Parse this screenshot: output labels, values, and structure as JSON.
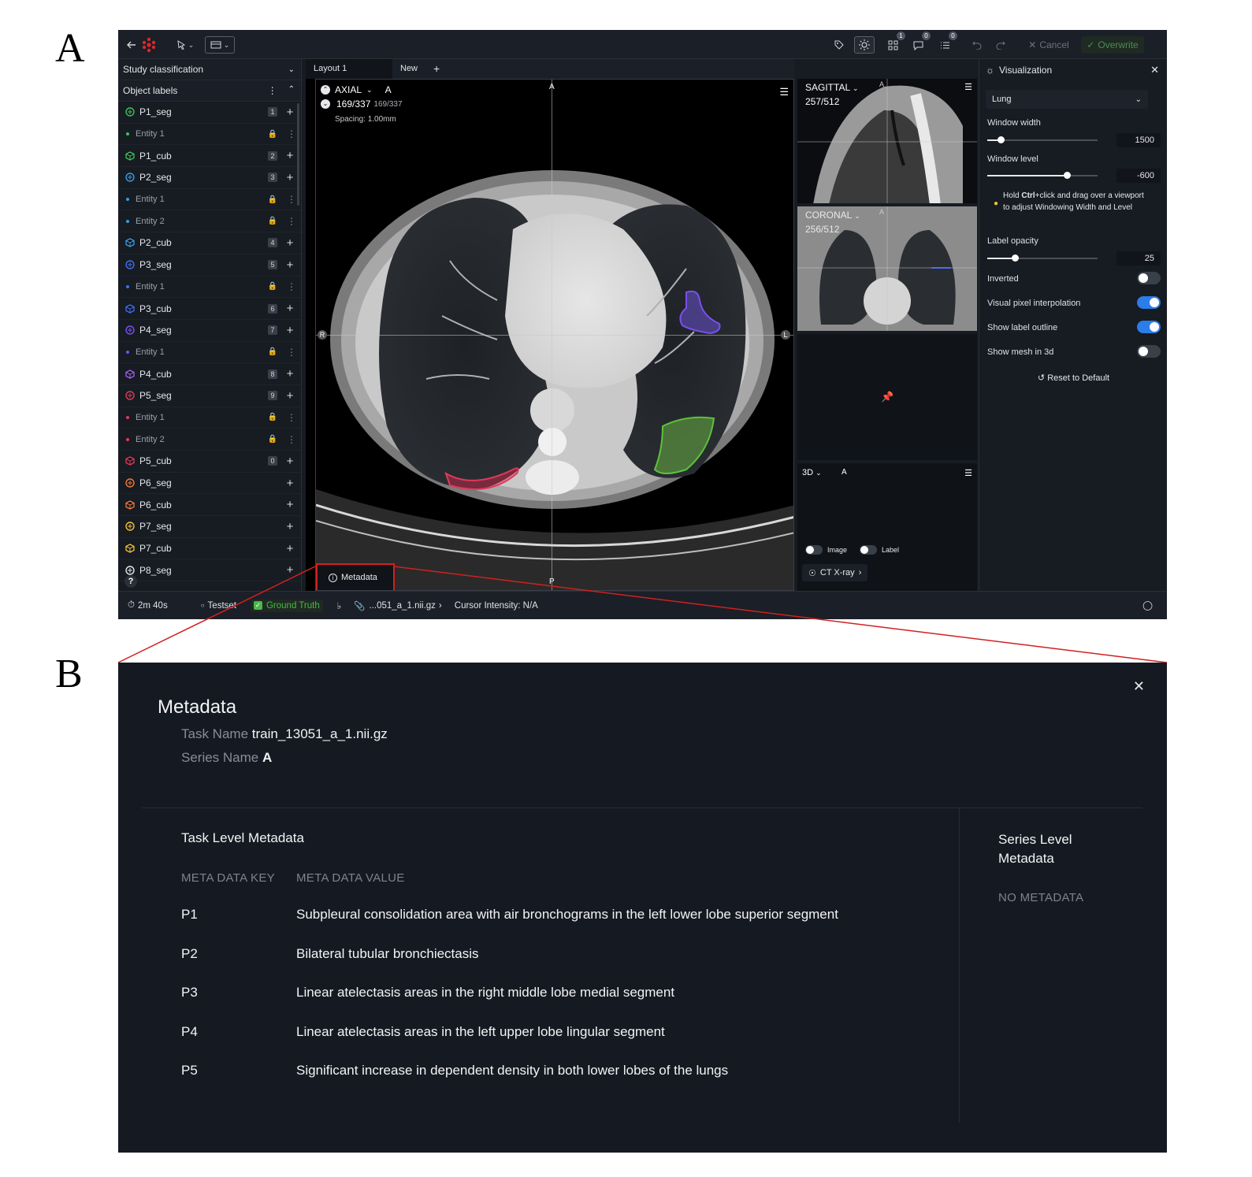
{
  "panels": {
    "a": "A",
    "b": "B"
  },
  "topbar": {
    "cancel": "Cancel",
    "overwrite": "Overwrite",
    "badge_grid": "1",
    "badge_chat": "0",
    "badge_list": "0"
  },
  "sidebar": {
    "study_classification": "Study classification",
    "object_labels": "Object labels",
    "help": "?",
    "items": [
      {
        "name": "P1_seg",
        "type": "seg",
        "color": "#3cc25a",
        "num": "1"
      },
      {
        "name": "Entity 1",
        "type": "entity",
        "color": "#3cc25a"
      },
      {
        "name": "P1_cub",
        "type": "cub",
        "color": "#3cc25a",
        "num": "2"
      },
      {
        "name": "P2_seg",
        "type": "seg",
        "color": "#3a9be0",
        "num": "3"
      },
      {
        "name": "Entity 1",
        "type": "entity",
        "color": "#3a9be0"
      },
      {
        "name": "Entity 2",
        "type": "entity",
        "color": "#3a9be0"
      },
      {
        "name": "P2_cub",
        "type": "cub",
        "color": "#3a9be0",
        "num": "4"
      },
      {
        "name": "P3_seg",
        "type": "seg",
        "color": "#3d6ff0",
        "num": "5"
      },
      {
        "name": "Entity 1",
        "type": "entity",
        "color": "#3d6ff0"
      },
      {
        "name": "P3_cub",
        "type": "cub",
        "color": "#3d6ff0",
        "num": "6"
      },
      {
        "name": "P4_seg",
        "type": "seg",
        "color": "#7a4ff0",
        "num": "7"
      },
      {
        "name": "Entity 1",
        "type": "entity",
        "color": "#7a4ff0"
      },
      {
        "name": "P4_cub",
        "type": "cub",
        "color": "#a55ff0",
        "num": "8"
      },
      {
        "name": "P5_seg",
        "type": "seg",
        "color": "#e03a5a",
        "num": "9"
      },
      {
        "name": "Entity 1",
        "type": "entity",
        "color": "#e03a5a"
      },
      {
        "name": "Entity 2",
        "type": "entity",
        "color": "#e03a5a"
      },
      {
        "name": "P5_cub",
        "type": "cub",
        "color": "#e03a5a",
        "num": "0"
      },
      {
        "name": "P6_seg",
        "type": "seg",
        "color": "#f07a3a",
        "num": ""
      },
      {
        "name": "P6_cub",
        "type": "cub",
        "color": "#f07a3a",
        "num": ""
      },
      {
        "name": "P7_seg",
        "type": "seg",
        "color": "#f0c23a",
        "num": ""
      },
      {
        "name": "P7_cub",
        "type": "cub",
        "color": "#f0c23a",
        "num": ""
      },
      {
        "name": "P8_seg",
        "type": "seg",
        "color": "#e6e6e6",
        "num": ""
      }
    ]
  },
  "viewer": {
    "tabs": [
      "Layout 1",
      "New",
      "+"
    ],
    "axial": {
      "label": "AXIAL",
      "series": "A",
      "slice": "169/337",
      "slice_small": "169/337",
      "spacing": "Spacing: 1.00mm",
      "top": "A",
      "bottom": "P",
      "left": "R",
      "right": "L"
    },
    "sagittal": {
      "label": "SAGITTAL",
      "slice": "257/512",
      "marker": "A"
    },
    "coronal": {
      "label": "CORONAL",
      "slice": "256/512",
      "marker": "A"
    },
    "view3d": {
      "label": "3D",
      "series": "A",
      "image": "Image",
      "label_toggle": "Label",
      "preset": "CT X-ray"
    },
    "metadata_button": "Metadata"
  },
  "visualization": {
    "title": "Visualization",
    "preset": "Lung",
    "window_width_label": "Window width",
    "window_width": "1500",
    "window_width_pos": 0.12,
    "window_level_label": "Window level",
    "window_level": "-600",
    "window_level_pos": 0.72,
    "hint_pre": "Hold ",
    "hint_bold": "Ctrl",
    "hint_post": "+click and drag over a viewport to adjust Windowing Width and Level",
    "label_opacity_label": "Label opacity",
    "label_opacity": "25",
    "label_opacity_pos": 0.25,
    "inverted": "Inverted",
    "interp": "Visual pixel interpolation",
    "outline": "Show label outline",
    "mesh": "Show mesh in 3d",
    "reset": "Reset to Default"
  },
  "statusbar": {
    "timer": "2m 40s",
    "set": "Testset",
    "ground_truth": "Ground Truth",
    "file": "...051_a_1.nii.gz",
    "cursor": "Cursor Intensity: N/A"
  },
  "metadata": {
    "title": "Metadata",
    "task_name_label": "Task Name",
    "task_name": "train_13051_a_1.nii.gz",
    "series_name_label": "Series Name",
    "series_name": "A",
    "task_level": "Task Level Metadata",
    "col_key": "META DATA KEY",
    "col_value": "META DATA VALUE",
    "series_level": "Series Level Metadata",
    "no_metadata": "NO METADATA",
    "rows": [
      {
        "key": "P1",
        "value": "Subpleural consolidation area with air bronchograms in the left lower lobe superior segment"
      },
      {
        "key": "P2",
        "value": "Bilateral tubular bronchiectasis"
      },
      {
        "key": "P3",
        "value": "Linear atelectasis areas in the right middle lobe medial segment"
      },
      {
        "key": "P4",
        "value": "Linear atelectasis areas in the left upper lobe lingular segment"
      },
      {
        "key": "P5",
        "value": "Significant increase in dependent density in both lower lobes of the lungs"
      }
    ]
  },
  "colors": {
    "accent": "#2b7de9",
    "highlight": "#d22020",
    "ground_truth": "#49b94a"
  }
}
